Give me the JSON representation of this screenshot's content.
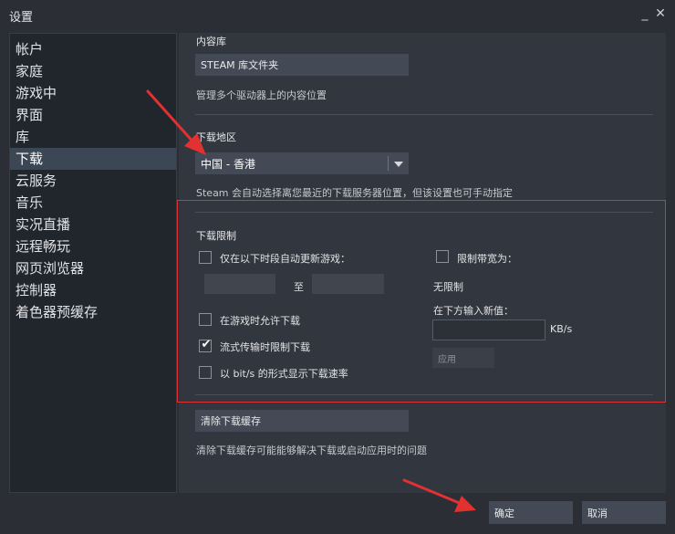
{
  "window": {
    "title": "设置",
    "minimize_glyph": "_",
    "close_glyph": "✕"
  },
  "sidebar": {
    "items": [
      {
        "label": "帐户"
      },
      {
        "label": "家庭"
      },
      {
        "label": "游戏中"
      },
      {
        "label": "界面"
      },
      {
        "label": "库"
      },
      {
        "label": "下载",
        "active": true
      },
      {
        "label": "云服务"
      },
      {
        "label": "音乐"
      },
      {
        "label": "实况直播"
      },
      {
        "label": "远程畅玩"
      },
      {
        "label": "网页浏览器"
      },
      {
        "label": "控制器"
      },
      {
        "label": "着色器预缓存"
      }
    ]
  },
  "content_library": {
    "heading": "内容库",
    "button_label": "STEAM 库文件夹",
    "description": "管理多个驱动器上的内容位置"
  },
  "download_region": {
    "heading": "下载地区",
    "selected_value": "中国 - 香港",
    "description": "Steam 会自动选择离您最近的下载服务器位置，但该设置也可手动指定"
  },
  "download_limits": {
    "heading": "下载限制",
    "auto_update_label": "仅在以下时段自动更新游戏：",
    "auto_update_checked": false,
    "time_separator": "至",
    "allow_while_playing_label": "在游戏时允许下载",
    "allow_while_playing_checked": false,
    "throttle_streaming_label": "流式传输时限制下载",
    "throttle_streaming_checked": true,
    "bits_display_label": "以 bit/s 的形式显示下载速率",
    "bits_display_checked": false,
    "limit_bandwidth_label": "限制带宽为：",
    "limit_bandwidth_checked": false,
    "unlimited_text": "无限制",
    "enter_new_value_label": "在下方输入新值：",
    "unit": "KB/s",
    "apply_label": "应用"
  },
  "clear_cache": {
    "button_label": "清除下载缓存",
    "description": "清除下载缓存可能能够解决下载或启动应用时的问题"
  },
  "footer": {
    "ok_label": "确定",
    "cancel_label": "取消"
  },
  "colors": {
    "window_bg": "#2b2e35",
    "sidebar_bg": "#21252c",
    "active_item": "#3b4755",
    "annotation_red": "#e23131"
  }
}
